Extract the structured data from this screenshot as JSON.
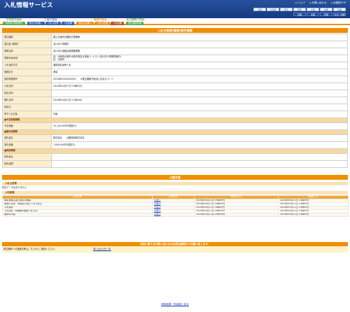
{
  "header": {
    "title": "入札情報サービス",
    "links": [
      "ヘルプ",
      "お問い合わせ",
      "全国版TOP"
    ],
    "pref_row1": [
      "全国",
      "北海道",
      "東北",
      "関東",
      "北陸",
      "中部",
      "近畿"
    ],
    "pref_row2": [
      "近畿",
      "中国",
      "四国",
      "九州・沖縄"
    ]
  },
  "menu": {
    "captions": [
      "令和期の検索",
      "工事の検索",
      "業務の検索",
      "発注機関の検索"
    ],
    "tabs": [
      {
        "label": "今和期の検索条件",
        "style": "green"
      },
      {
        "label": "発注の見通し",
        "style": "blue"
      },
      {
        "label": "入札公告等",
        "style": "blue"
      },
      {
        "label": "入札結果",
        "style": "blue"
      },
      {
        "label": "発注の見通し",
        "style": "orange"
      },
      {
        "label": "入札公告等",
        "style": "orange"
      },
      {
        "label": "入札結果",
        "style": "dark"
      },
      {
        "label": "発注機関情報",
        "style": "green"
      }
    ]
  },
  "page_title": "入札の経過(業務)案件概要",
  "detail": [
    {
      "k": "発注機関",
      "v": "国土交通省近畿地方整備局"
    },
    {
      "k": "発注者 事務所",
      "v": "淀川河川事務所"
    },
    {
      "k": "業務名称",
      "v": "淀川河川道路台帳整備業務"
    },
    {
      "k": "業務対象地域",
      "v": "自：大阪府大阪市大阪市西区九条南１-４-19（淀川河川事務所管内）\n至：大阪府"
    },
    {
      "k": "入札契約方式",
      "v": "通常指名競争入札"
    },
    {
      "k": "業務区分",
      "v": "測量"
    },
    {
      "k": "契約管理番号",
      "v": "2024884320040004　　※発注機関が独自に定めるコード"
    },
    {
      "k": "公告日時",
      "v": "2024年02月27日 10時00分"
    },
    {
      "k": "指名日時",
      "v": ""
    },
    {
      "k": "開札日時",
      "v": "2024年04月10日 11時00分"
    },
    {
      "k": "契約日",
      "v": ""
    },
    {
      "k": "電子入札対象",
      "v": "対象"
    },
    {
      "section": "■予定価格情報"
    },
    {
      "k": "予定価格",
      "v": "10,120,000円(税抜き)"
    },
    {
      "section": "■落札者情報"
    },
    {
      "k": "落札者名",
      "v": "株式会社　　近畿技術株式会社"
    },
    {
      "k": "落札価格",
      "v": "7,850,000円(税抜き)"
    },
    {
      "section": "■契約情報"
    },
    {
      "k": "契約者名",
      "v": ""
    },
    {
      "k": "契約金額",
      "v": ""
    }
  ],
  "docs_bar": "公開文書",
  "public_notice": {
    "head": "入札公告等",
    "text": "該当データはありません"
  },
  "bid_result": {
    "head": "入札経過",
    "columns": [
      "文書名称",
      "公開状況",
      "掲載年月日",
      "掲載終了日"
    ],
    "rows": [
      [
        "指名業者名及び指名の理由",
        "公開中",
        "2024年04月12日 19時09分",
        "2024年05月12日 23時00分"
      ],
      [
        "業務の名称、業務区分及び入札予定日",
        "公開中",
        "2024年04月12日 16時39分",
        "2024年05月12日 23時00分"
      ],
      [
        "入札調書",
        "公開中",
        "2024年04月12日 16時39分",
        "2024年05月12日 23時00分"
      ],
      [
        "入札調書（低価格)(差異入札方式)",
        "公開中",
        "2024年04月12日 16時39分",
        "2024年05月12日 23時00分"
      ],
      [
        "契約の内容",
        "公開中",
        "2024年04月12日 16時39分",
        "2024年05月12日 23時00分"
      ]
    ]
  },
  "contact_bar": "内容に関するお問い合わせは各発注機関までお願い致します。",
  "contact": {
    "left": "発注機関への連絡先等はこちらからご確認ください。",
    "link": "問い合わせ先一覧"
  },
  "back_link": "検索結果一覧画面に戻る"
}
